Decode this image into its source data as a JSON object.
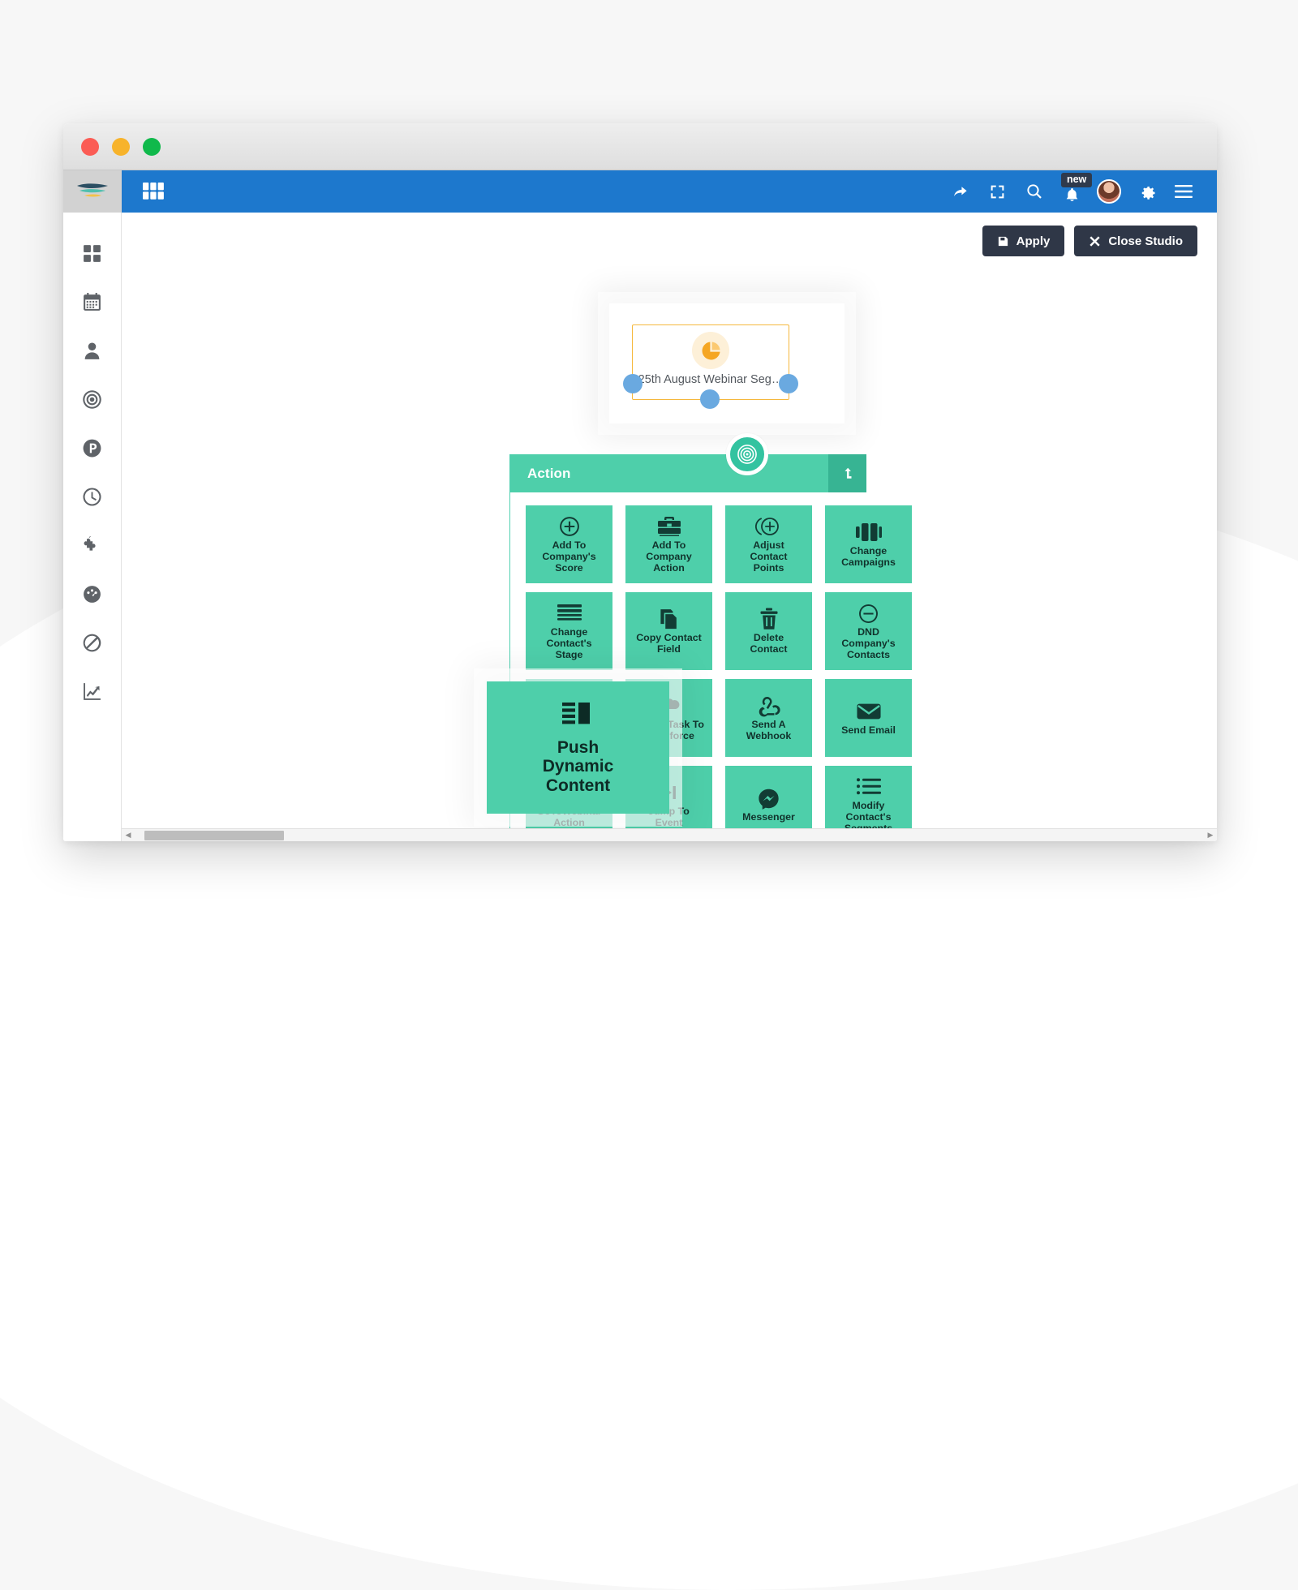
{
  "window": {
    "traffic_lights": [
      "close",
      "minimize",
      "maximize"
    ]
  },
  "rail": {
    "logo": "brand-logo",
    "items": [
      {
        "name": "dashboard",
        "icon": "grid-icon"
      },
      {
        "name": "calendar",
        "icon": "calendar-icon"
      },
      {
        "name": "contacts",
        "icon": "person-icon"
      },
      {
        "name": "segments",
        "icon": "target-icon"
      },
      {
        "name": "pages",
        "icon": "p-circle-icon"
      },
      {
        "name": "history",
        "icon": "clock-icon"
      },
      {
        "name": "integrations",
        "icon": "puzzle-icon"
      },
      {
        "name": "performance",
        "icon": "speedometer-icon"
      },
      {
        "name": "suppression",
        "icon": "block-icon"
      },
      {
        "name": "reports",
        "icon": "trending-up-icon"
      }
    ]
  },
  "topbar": {
    "apps_icon": "apps-grid-icon",
    "actions": [
      {
        "name": "share",
        "icon": "share-arrow-icon"
      },
      {
        "name": "fullscreen",
        "icon": "expand-icon"
      },
      {
        "name": "search",
        "icon": "search-icon"
      },
      {
        "name": "notifications",
        "icon": "bell-icon",
        "badge": "new"
      },
      {
        "name": "profile",
        "icon": "avatar"
      },
      {
        "name": "settings",
        "icon": "gear-icon"
      },
      {
        "name": "menu",
        "icon": "hamburger-icon"
      }
    ],
    "notification_badge": "new",
    "brand_color": "#1d78cd"
  },
  "canvas": {
    "apply_button": "Apply",
    "close_button": "Close Studio",
    "segment_node": {
      "label": "25th August Webinar Seg…",
      "icon": "pie-chart-icon",
      "accent_color": "#f5b83d",
      "port_color": "#6aa9e0"
    },
    "connector_icon": "target-icon",
    "connector_color": "#33c3a0"
  },
  "palette": {
    "title": "Action",
    "collapse_icon": "arrow-up-turn-icon",
    "header_color": "#4ecfaa",
    "tile_color": "#4ecfaa",
    "tiles": [
      {
        "label": "Add To\nCompany's\nScore",
        "icon": "plus-circle-icon"
      },
      {
        "label": "Add To\nCompany\nAction",
        "icon": "briefcase-icon"
      },
      {
        "label": "Adjust\nContact\nPoints",
        "icon": "plus-circle-arc-icon"
      },
      {
        "label": "Change\nCampaigns",
        "icon": "campaign-bars-icon"
      },
      {
        "label": "Change\nContact's\nStage",
        "icon": "stacked-lines-icon"
      },
      {
        "label": "Copy Contact\nField",
        "icon": "copy-icon"
      },
      {
        "label": "Delete\nContact",
        "icon": "trash-icon"
      },
      {
        "label": "DND\nCompany's\nContacts",
        "icon": "minus-circle-icon"
      },
      {
        "label": "Push Dynamic\nContent",
        "icon": "dynamic-content-icon"
      },
      {
        "label": "Create Task To\nSalesforce",
        "icon": "salesforce-cloud-icon"
      },
      {
        "label": "Send A\nWebhook",
        "icon": "webhook-icon"
      },
      {
        "label": "Send Email",
        "icon": "envelope-icon"
      },
      {
        "label": "GoToWebinar\nAction",
        "icon": "code-brackets-icon"
      },
      {
        "label": "Jump To\nEvent",
        "icon": "skip-next-icon"
      },
      {
        "label": "Messenger",
        "icon": "messenger-icon"
      },
      {
        "label": "Modify\nContact's\nSegments",
        "icon": "list-icon"
      },
      {
        "label": "",
        "icon": "partial-icon-1"
      },
      {
        "label": "",
        "icon": "partial-icon-2"
      },
      {
        "label": "",
        "icon": "partial-icon-3"
      },
      {
        "label": "",
        "icon": "partial-icon-4"
      }
    ]
  },
  "drag_ghost": {
    "label": "Push\nDynamic\nContent",
    "icon": "dynamic-content-icon"
  },
  "scrollbar": {
    "left_arrow": "◀",
    "right_arrow": "▶"
  }
}
